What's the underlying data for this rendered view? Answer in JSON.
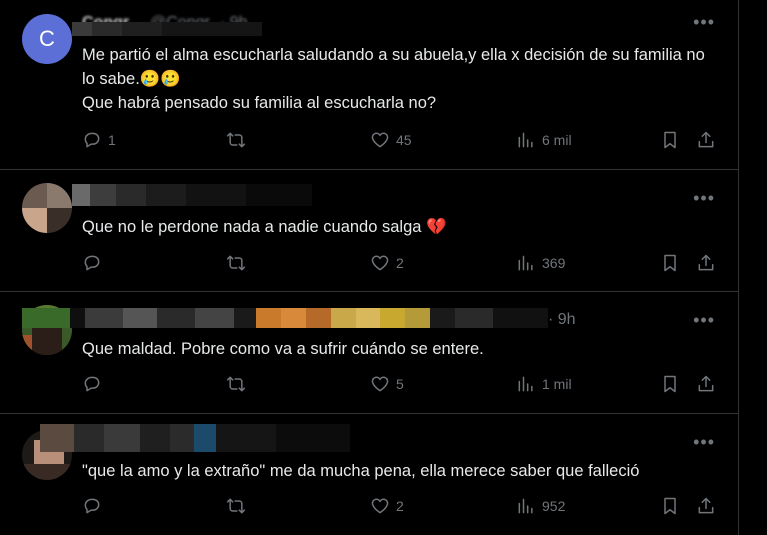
{
  "colors": {
    "background": "#000000",
    "text": "#e7e9ea",
    "muted": "#71767b",
    "divider": "#2f3336",
    "heart": "#f91880"
  },
  "posts": [
    {
      "avatar_letter": "C",
      "name": "Congr",
      "handle": "@Congr",
      "time": "· 9h",
      "text": "Me partió el alma escucharla saludando a su abuela,y ella x decisión de su familia no lo sabe.🥲🥲\nQue habrá pensado su familia al escucharla no?",
      "replies": "1",
      "retweets": "",
      "likes": "45",
      "views": "6 mil"
    },
    {
      "text": "Que no le perdone nada a nadie cuando salga 💔",
      "replies": "",
      "retweets": "",
      "likes": "2",
      "views": "369"
    },
    {
      "time": "· 9h",
      "text": "Que maldad. Pobre como va a sufrir cuándo se entere.",
      "replies": "",
      "retweets": "",
      "likes": "5",
      "views": "1 mil"
    },
    {
      "text": "\"que la amo y la extraño\" me da mucha pena, ella merece saber que falleció",
      "replies": "",
      "retweets": "",
      "likes": "2",
      "views": "952"
    }
  ],
  "icons": {
    "more": "more-dots-icon",
    "reply": "reply-icon",
    "retweet": "retweet-icon",
    "like": "heart-icon",
    "views": "views-bar-icon",
    "bookmark": "bookmark-icon",
    "share": "share-icon"
  }
}
